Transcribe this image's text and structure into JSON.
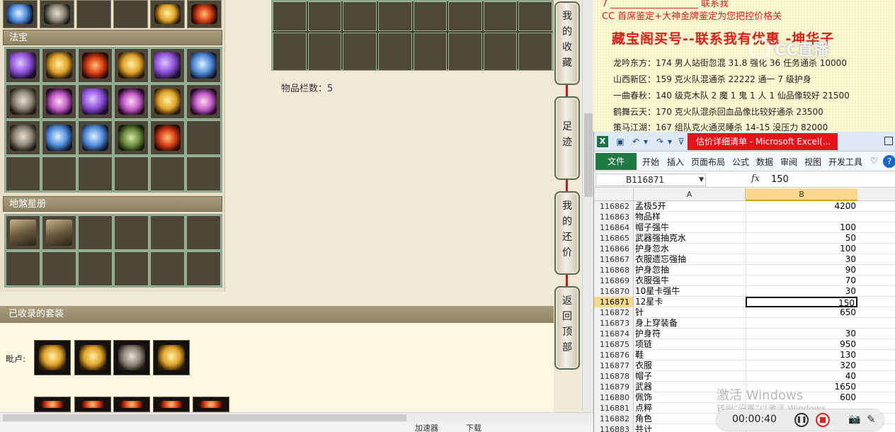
{
  "left_panel": {
    "section_fabao": "法宝",
    "section_disha": "地煞星册"
  },
  "center": {
    "item_count": "物品栏数：5"
  },
  "side_tabs": [
    {
      "id": "my-collection",
      "chars": [
        "我",
        "的",
        "收",
        "藏"
      ]
    },
    {
      "id": "footprint",
      "chars": [
        "足",
        "迹"
      ]
    },
    {
      "id": "my-counter-offer",
      "chars": [
        "我",
        "的",
        "还",
        "价"
      ]
    },
    {
      "id": "back-to-top",
      "chars": [
        "返",
        "回",
        "顶",
        "部"
      ]
    }
  ],
  "set_area": {
    "header": "已收录的套装",
    "label": "毗卢:"
  },
  "bottom_bar": {
    "left": "加速器",
    "right": "下载"
  },
  "doc": {
    "red_line1": "7   ___________________ 联系我",
    "red_line2": "CC 首席鉴定+大神金牌鉴定为您把控价格关",
    "title": "藏宝阁买号--联系我有优惠 -坤华子",
    "lines": [
      "龙吟东方：174 男人站街忽混 31.8 强化 36 任务通杀 10000",
      "山西新区：159 克火队混通杀 22222 通一 7 级护身",
      "一曲春秋：140 级克木队 2 魔 1 鬼 1 人 1 仙品像较好 21500",
      "鹤舞云天：170 克火队混杀回血品像比较好通杀 23500",
      "策马江湖：167 组队克火通灵睡杀 14-15 没压力 82000"
    ]
  },
  "watermark": "CC直播",
  "excel": {
    "title": "估价详细清单 - Microsoft Excel(...",
    "file_tab": "文件",
    "tabs": [
      "开始",
      "插入",
      "页面布局",
      "公式",
      "数据",
      "审阅",
      "视图",
      "开发工具"
    ],
    "namebox": "B116871",
    "fx": "fx",
    "formula_value": "150",
    "col_a": "A",
    "col_b": "B",
    "rows": [
      {
        "num": "116862",
        "a": "孟极5开",
        "b": "4200"
      },
      {
        "num": "116863",
        "a": "物品样",
        "b": ""
      },
      {
        "num": "116864",
        "a": "帽子强牛",
        "b": "100"
      },
      {
        "num": "116865",
        "a": "武器强抽克水",
        "b": "50"
      },
      {
        "num": "116866",
        "a": "护身忽水",
        "b": "100"
      },
      {
        "num": "116867",
        "a": "衣服遗忘强抽",
        "b": "30"
      },
      {
        "num": "116868",
        "a": "护身忽抽",
        "b": "90"
      },
      {
        "num": "116869",
        "a": "衣服强牛",
        "b": "70"
      },
      {
        "num": "116870",
        "a": "10星卡强牛",
        "b": "30"
      },
      {
        "num": "116871",
        "a": "12星卡",
        "b": "150"
      },
      {
        "num": "116872",
        "a": "针",
        "b": "650"
      },
      {
        "num": "116873",
        "a": "身上穿装备",
        "b": ""
      },
      {
        "num": "116874",
        "a": "护身符",
        "b": "30"
      },
      {
        "num": "116875",
        "a": "项链",
        "b": "950"
      },
      {
        "num": "116876",
        "a": "鞋",
        "b": "130"
      },
      {
        "num": "116877",
        "a": "衣服",
        "b": "320"
      },
      {
        "num": "116878",
        "a": "帽子",
        "b": "40"
      },
      {
        "num": "116879",
        "a": "武器",
        "b": "1650"
      },
      {
        "num": "116880",
        "a": "佩饰",
        "b": "600"
      },
      {
        "num": "116881",
        "a": "点粹",
        "b": ""
      },
      {
        "num": "116882",
        "a": "角色",
        "b": ""
      },
      {
        "num": "116883",
        "a": "共计",
        "b": ""
      }
    ],
    "active_row": "116871"
  },
  "windows_watermark": {
    "line1": "激活 Windows",
    "line2": "转到“设置”以激活 Windows。"
  },
  "recorder": {
    "time": "00:00:40"
  },
  "icons": {
    "qa_save": "save-icon",
    "qa_undo": "undo-icon",
    "qa_redo": "redo-icon"
  }
}
